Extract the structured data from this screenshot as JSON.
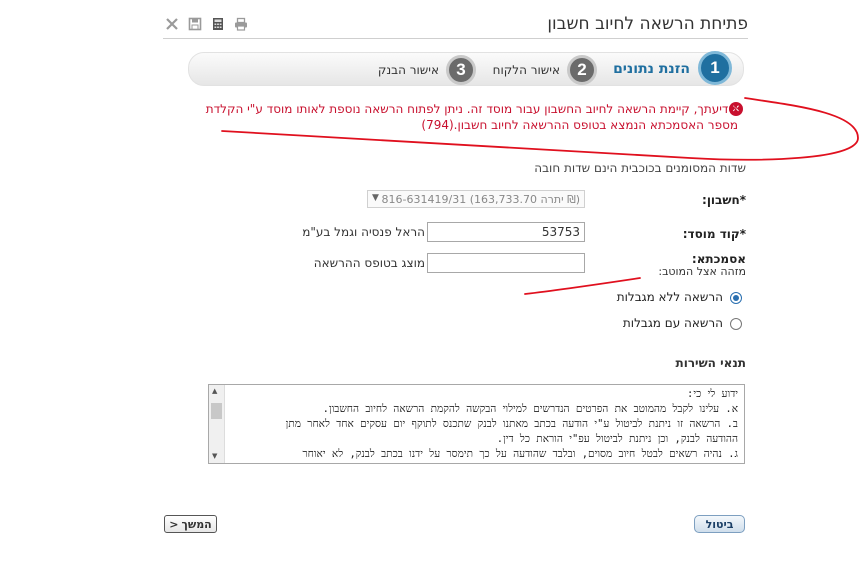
{
  "header": {
    "title": "פתיחת הרשאה לחיוב חשבון",
    "toolbar_icons": [
      "close-x-icon",
      "save-icon",
      "calculator-icon",
      "print-icon"
    ]
  },
  "steps": [
    {
      "number": "1",
      "label": "הזנת נתונים",
      "active": true
    },
    {
      "number": "2",
      "label": "אישור הלקוח",
      "active": false
    },
    {
      "number": "3",
      "label": "אישור הבנק",
      "active": false
    }
  ],
  "error": {
    "icon": "error-x-icon",
    "text": "לידיעתך, קיימת הרשאה לחיוב החשבון עבור מוסד זה. ניתן לפתוח הרשאה נוספת לאותו מוסד ע\"י הקלדת מספר האסמכתא הנמצא בטופס ההרשאה לחיוב חשבון.(794)"
  },
  "required_hint": "שדות המסומנים בכוכבית הינם שדות חובה",
  "form": {
    "account_label": "*חשבון:",
    "account_value": "816-631419/31 (יתרה 163,733.70 ₪)",
    "institution_label": "*קוד מוסד:",
    "institution_value": "53753",
    "institution_name": "הראל פנסיה וגמל בע\"מ",
    "reference_label": "אסמכתא:",
    "reference_sublabel": "מזהה אצל המוטב:",
    "reference_value": "",
    "reference_note": "מוצג בטופס ההרשאה",
    "radio_unlimited": "הרשאה ללא מגבלות",
    "radio_limited": "הרשאה עם מגבלות",
    "selected": "unlimited"
  },
  "terms": {
    "title": "תנאי השירות",
    "lines": [
      "ידוע לי כי:",
      "א. עלינו לקבל מהמוטב את הפרטים הנדרשים למילוי הבקשה להקמת הרשאה לחיוב החשבון.",
      "ב. הרשאה זו ניתנת לביטול ע\"י הודעה בכתב מאתנו לבנק שתכנס לתוקף יום עסקים אחד לאחר מתן",
      "ההודעה לבנק, וכן ניתנת לביטול עפ\"י הוראת כל דין.",
      "ג. נהיה רשאים לבטל חיוב מסוים, ובלבד שהודעה על כך תימסר על ידנו בכתב לבנק, לא יאוחר"
    ]
  },
  "buttons": {
    "next": "המשך",
    "cancel": "ביטול"
  },
  "colors": {
    "accent": "#1f6fa0",
    "error": "#c8102e",
    "annotation": "#e0101e"
  }
}
